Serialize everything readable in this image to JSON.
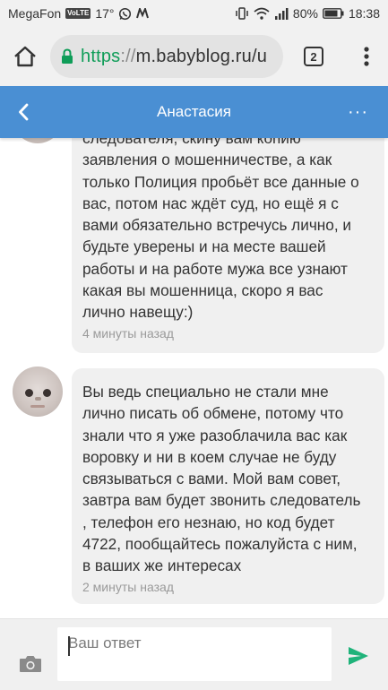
{
  "status_bar": {
    "carrier": "MegaFon",
    "carrier_badge": "VoLTE",
    "temperature": "17°",
    "battery": "80%",
    "time": "18:38"
  },
  "browser": {
    "url_scheme": "https",
    "url_sep": "://",
    "url_host": "m.babyblog.ru/u",
    "tab_count": "2"
  },
  "header": {
    "title": "Анастасия",
    "more": "···"
  },
  "messages": [
    {
      "text": "следователя, скину вам копию\nзаявления о мошенничестве, а как\nтолько Полиция пробьёт все данные о\nвас, потом нас ждёт суд, но ещё я с\nвами обязательно встречусь лично, и\nбудьте уверены и на месте вашей\nработы и на работе мужа все узнают\nкакая вы мошенница, скоро я вас\nлично навещу:)",
      "time": "4 минуты назад"
    },
    {
      "text": "Вы ведь специально не стали мне\nлично писать об обмене, потому что\nзнали что я уже разоблачила вас как\nворовку и ни в коем случае не буду\nсвязываться с вами. Мой вам совет,\nзавтра вам будет звонить следователь\n, телефон его незнаю, но код будет\n4722, пообщайтесь пожалуйста с ним,\nв ваших же интересах",
      "time": "2 минуты назад"
    }
  ],
  "compose": {
    "placeholder": "Ваш ответ"
  },
  "colors": {
    "header_bg": "#4a8fd3",
    "bubble_bg": "#f0f0f0",
    "send_icon": "#1fb37a",
    "lock_icon": "#0f9d58"
  },
  "icons": [
    "home-icon",
    "lock-icon",
    "tabs-icon",
    "kebab-menu-icon",
    "back-chevron-icon",
    "camera-icon",
    "send-icon"
  ]
}
